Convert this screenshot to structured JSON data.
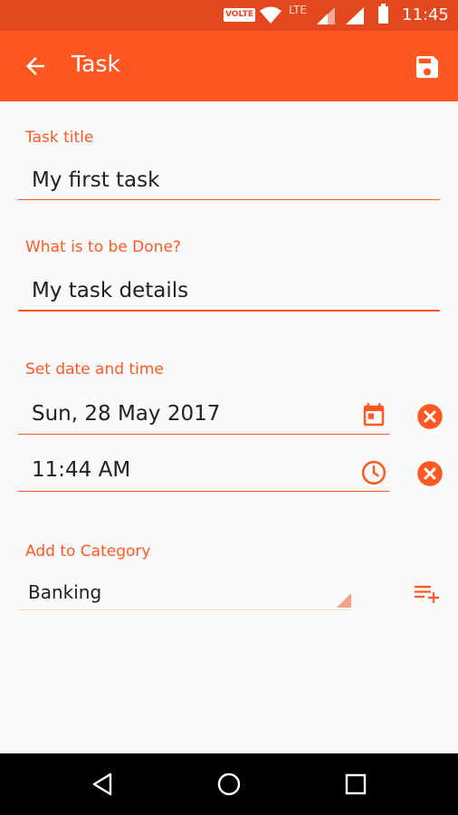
{
  "status_bar": {
    "volte": "VOLTE",
    "network": "LTE",
    "time": "11:45"
  },
  "app_bar": {
    "title": "Task",
    "back_icon": "arrow-left-icon",
    "save_icon": "save-icon"
  },
  "form": {
    "task_title": {
      "label": "Task title",
      "value": "My first task"
    },
    "details": {
      "label": "What is to be Done?",
      "value": "My task details"
    },
    "datetime": {
      "label": "Set date and time",
      "date_value": "Sun, 28 May 2017",
      "time_value": "11:44 AM",
      "calendar_icon": "calendar-icon",
      "clock_icon": "clock-icon",
      "clear_icon": "clear-circle-icon"
    },
    "category": {
      "label": "Add to Category",
      "selected": "Banking",
      "add_icon": "playlist-add-icon"
    }
  },
  "colors": {
    "accent": "#ff5722",
    "status_bar": "#e4481f"
  }
}
